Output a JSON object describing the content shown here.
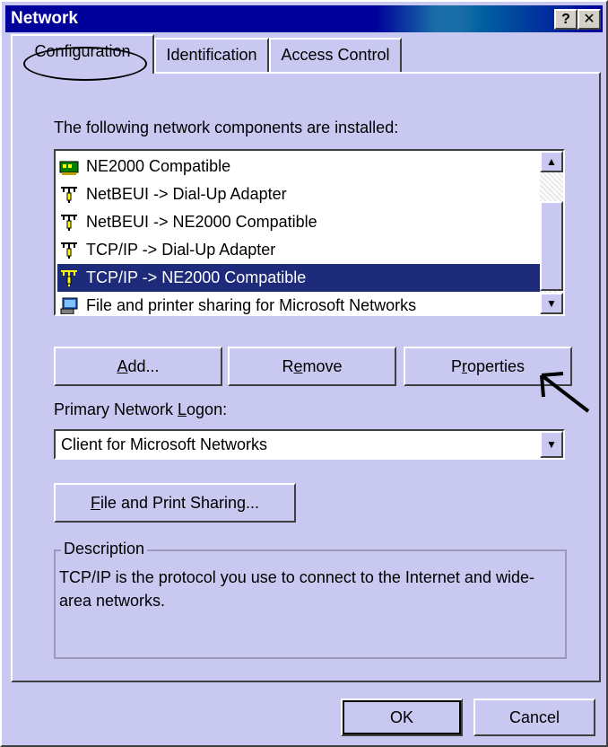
{
  "window": {
    "title": "Network",
    "help_glyph": "?",
    "close_glyph": "✕"
  },
  "tabs": [
    {
      "label": "Configuration",
      "active": true
    },
    {
      "label": "Identification",
      "active": false
    },
    {
      "label": "Access Control",
      "active": false
    }
  ],
  "components": {
    "label": "The following network components are installed:",
    "items": [
      {
        "label": "NE2000 Compatible",
        "icon": "network-card-icon",
        "selected": false
      },
      {
        "label": "NetBEUI -> Dial-Up Adapter",
        "icon": "protocol-icon",
        "selected": false
      },
      {
        "label": "NetBEUI -> NE2000 Compatible",
        "icon": "protocol-icon",
        "selected": false
      },
      {
        "label": "TCP/IP -> Dial-Up Adapter",
        "icon": "protocol-icon",
        "selected": false
      },
      {
        "label": "TCP/IP -> NE2000 Compatible",
        "icon": "protocol-icon",
        "selected": true
      },
      {
        "label": "File and printer sharing for Microsoft Networks",
        "icon": "file-printer-sharing-icon",
        "selected": false
      }
    ]
  },
  "buttons": {
    "add": "Add...",
    "remove": "Remove",
    "properties": "Properties",
    "file_print_sharing": "File and Print Sharing...",
    "ok": "OK",
    "cancel": "Cancel"
  },
  "logon": {
    "label": "Primary Network Logon:",
    "value": "Client for Microsoft Networks"
  },
  "description": {
    "legend": "Description",
    "text": "TCP/IP is the protocol you use to connect to the Internet and wide-area networks."
  },
  "colors": {
    "title_bar": "#00009a",
    "dialog_face": "#c8c8f0",
    "selection": "#1e2a7a"
  }
}
